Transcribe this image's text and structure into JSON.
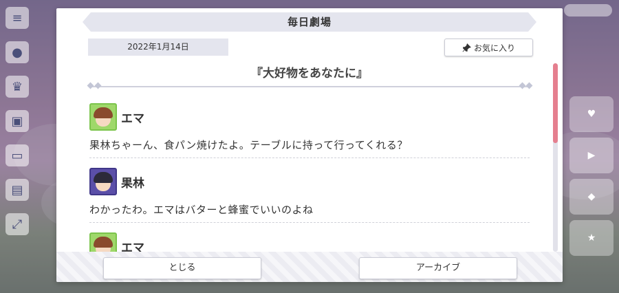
{
  "dialog": {
    "title": "毎日劇場",
    "date": "2022年1月14日",
    "favorite_label": "お気に入り",
    "story_title": "『大好物をあなたに』",
    "messages": [
      {
        "speaker": "エマ",
        "text": "果林ちゃーん、食パン焼けたよ。テーブルに持って行ってくれる？"
      },
      {
        "speaker": "果林",
        "text": "わかったわ。エマはバターと蜂蜜でいいのよね"
      },
      {
        "speaker": "エマ",
        "text": ""
      }
    ],
    "close_label": "とじる",
    "archive_label": "アーカイブ"
  },
  "colors": {
    "accent_scroll": "#e57f8f",
    "emma_avatar": "#9fd86a",
    "karin_avatar": "#5b4fa8"
  }
}
